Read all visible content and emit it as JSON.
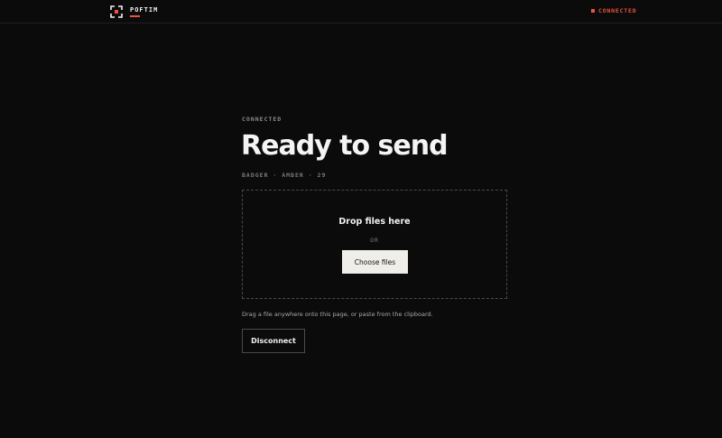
{
  "header": {
    "logo_icon": "viewfinder-icon",
    "brand": "POFTIM",
    "status_label": "CONNECTED"
  },
  "main": {
    "eyebrow": "CONNECTED",
    "title": "Ready to send",
    "peer_code": "BADGER · AMBER · 29",
    "dropzone": {
      "title": "Drop files here",
      "or_label": "OR",
      "choose_button": "Choose files"
    },
    "hint": "Drag a file anywhere onto this page, or paste from the clipboard.",
    "disconnect_button": "Disconnect"
  },
  "colors": {
    "background": "#0b0b0b",
    "accent": "#e8553a",
    "text": "#f2f2f2",
    "muted": "#7a7a7a",
    "button_light": "#efeee9"
  }
}
